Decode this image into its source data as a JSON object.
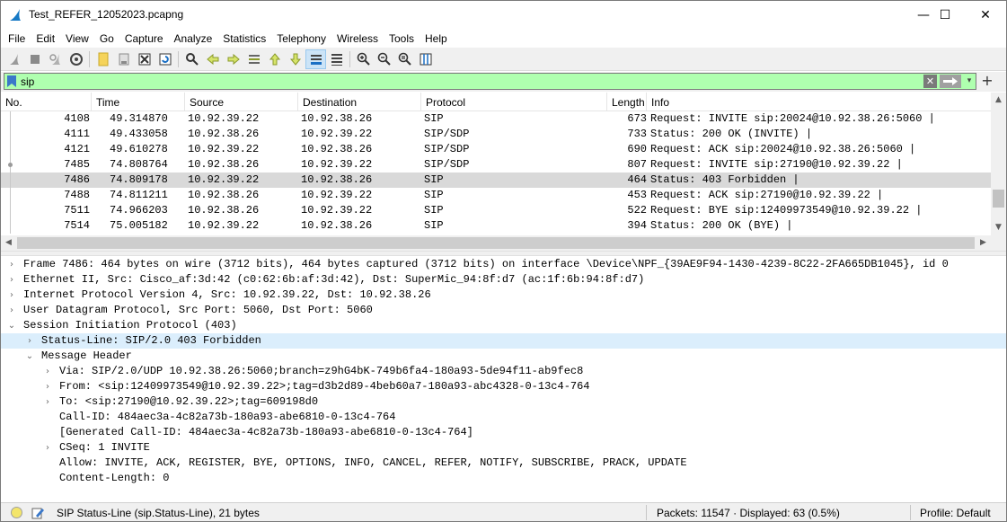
{
  "window": {
    "title": "Test_REFER_12052023.pcapng",
    "controls": {
      "minimize": "—",
      "maximize": "☐",
      "close": "✕"
    }
  },
  "menu": [
    "File",
    "Edit",
    "View",
    "Go",
    "Capture",
    "Analyze",
    "Statistics",
    "Telephony",
    "Wireless",
    "Tools",
    "Help"
  ],
  "toolbar_icons": [
    "start-capture",
    "stop-capture",
    "restart-capture",
    "capture-options",
    "open-file",
    "save-file",
    "close-file",
    "reload-file",
    "find-packet",
    "go-back",
    "go-forward",
    "go-to-packet",
    "go-first",
    "go-last",
    "auto-scroll",
    "colorize",
    "zoom-in",
    "zoom-out",
    "zoom-normal",
    "resize-columns"
  ],
  "filter": {
    "value": "sip",
    "clear_label": "✕",
    "dropdown_label": "▾",
    "add_label": "+"
  },
  "packet_list": {
    "columns": [
      "No.",
      "Time",
      "Source",
      "Destination",
      "Protocol",
      "Length",
      "Info"
    ],
    "rows": [
      {
        "no": "4108",
        "time": "49.314870",
        "src": "10.92.39.22",
        "dst": "10.92.38.26",
        "proto": "SIP",
        "len": "673",
        "info": "Request: INVITE sip:20024@10.92.38.26:5060 |"
      },
      {
        "no": "4111",
        "time": "49.433058",
        "src": "10.92.38.26",
        "dst": "10.92.39.22",
        "proto": "SIP/SDP",
        "len": "733",
        "info": "Status: 200 OK (INVITE) |"
      },
      {
        "no": "4121",
        "time": "49.610278",
        "src": "10.92.39.22",
        "dst": "10.92.38.26",
        "proto": "SIP/SDP",
        "len": "690",
        "info": "Request: ACK sip:20024@10.92.38.26:5060 |"
      },
      {
        "no": "7485",
        "time": "74.808764",
        "src": "10.92.38.26",
        "dst": "10.92.39.22",
        "proto": "SIP/SDP",
        "len": "807",
        "info": "Request: INVITE sip:27190@10.92.39.22 |"
      },
      {
        "no": "7486",
        "time": "74.809178",
        "src": "10.92.39.22",
        "dst": "10.92.38.26",
        "proto": "SIP",
        "len": "464",
        "info": "Status: 403 Forbidden |"
      },
      {
        "no": "7488",
        "time": "74.811211",
        "src": "10.92.38.26",
        "dst": "10.92.39.22",
        "proto": "SIP",
        "len": "453",
        "info": "Request: ACK sip:27190@10.92.39.22 |"
      },
      {
        "no": "7511",
        "time": "74.966203",
        "src": "10.92.38.26",
        "dst": "10.92.39.22",
        "proto": "SIP",
        "len": "522",
        "info": "Request: BYE sip:12409973549@10.92.39.22 |"
      },
      {
        "no": "7514",
        "time": "75.005182",
        "src": "10.92.39.22",
        "dst": "10.92.38.26",
        "proto": "SIP",
        "len": "394",
        "info": "Status: 200 OK (BYE) |"
      }
    ],
    "selected_no": "7486"
  },
  "details": [
    {
      "text": "Frame 7486: 464 bytes on wire (3712 bits), 464 bytes captured (3712 bits) on interface \\Device\\NPF_{39AE9F94-1430-4239-8C22-2FA665DB1045}, id 0",
      "arrow": ">"
    },
    {
      "text": "Ethernet II, Src: Cisco_af:3d:42 (c0:62:6b:af:3d:42), Dst: SuperMic_94:8f:d7 (ac:1f:6b:94:8f:d7)",
      "arrow": ">"
    },
    {
      "text": "Internet Protocol Version 4, Src: 10.92.39.22, Dst: 10.92.38.26",
      "arrow": ">"
    },
    {
      "text": "User Datagram Protocol, Src Port: 5060, Dst Port: 5060",
      "arrow": ">"
    },
    {
      "text": "Session Initiation Protocol (403)",
      "arrow": "v"
    },
    {
      "text": "Status-Line: SIP/2.0 403 Forbidden",
      "arrow": ">"
    },
    {
      "text": "Message Header",
      "arrow": "v"
    },
    {
      "text": "Via: SIP/2.0/UDP 10.92.38.26:5060;branch=z9hG4bK-749b6fa4-180a93-5de94f11-ab9fec8",
      "arrow": ">"
    },
    {
      "text": "From: <sip:12409973549@10.92.39.22>;tag=d3b2d89-4beb60a7-180a93-abc4328-0-13c4-764",
      "arrow": ">"
    },
    {
      "text": "To: <sip:27190@10.92.39.22>;tag=609198d0",
      "arrow": ">"
    },
    {
      "text": "Call-ID: 484aec3a-4c82a73b-180a93-abe6810-0-13c4-764",
      "arrow": ""
    },
    {
      "text": "[Generated Call-ID: 484aec3a-4c82a73b-180a93-abe6810-0-13c4-764]",
      "arrow": ""
    },
    {
      "text": "CSeq: 1 INVITE",
      "arrow": ">"
    },
    {
      "text": "Allow: INVITE, ACK, REGISTER, BYE, OPTIONS, INFO, CANCEL, REFER, NOTIFY, SUBSCRIBE, PRACK, UPDATE",
      "arrow": ""
    },
    {
      "text": "Content-Length: 0",
      "arrow": ""
    }
  ],
  "status": {
    "field_info": "SIP Status-Line (sip.Status-Line), 21 bytes",
    "packets": "Packets: 11547 · Displayed: 63 (0.5%)",
    "profile": "Profile: Default"
  },
  "colors": {
    "filter_valid": "#afffaf",
    "selected_row": "#d9d9d9",
    "highlight_detail": "#dbeefc"
  }
}
